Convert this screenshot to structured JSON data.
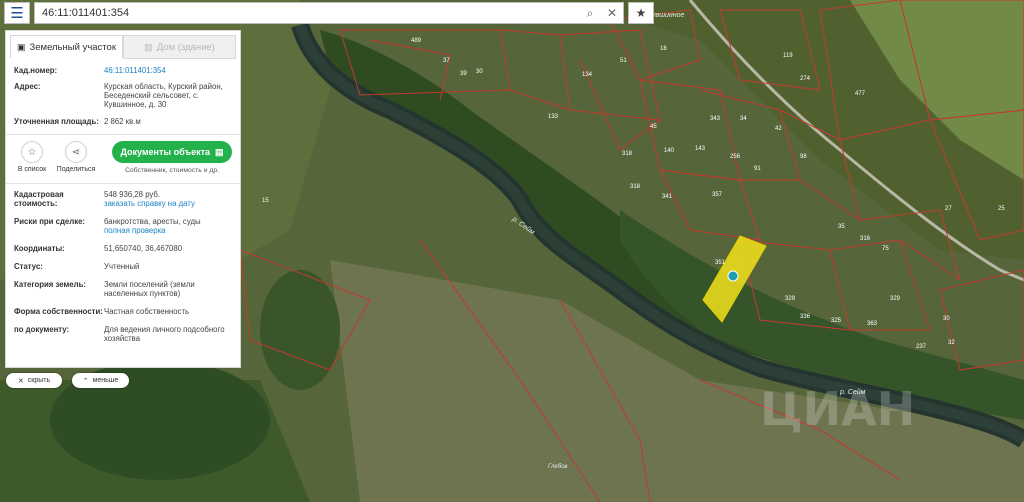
{
  "search": {
    "value": "46:11:011401:354",
    "search_icon": "search-icon",
    "clear_icon": "close-icon"
  },
  "map": {
    "village_label": "Кувшинное",
    "river_label": "р. Сейм",
    "river_label_2": "р. Сейм",
    "watermark": "ЦИАН",
    "selected_plot_color": "#f2e21b",
    "plot_numbers": [
      "489",
      "37",
      "39",
      "30",
      "134",
      "51",
      "18",
      "133",
      "45",
      "140",
      "34",
      "316",
      "318",
      "256",
      "341",
      "42",
      "91",
      "143",
      "343",
      "318",
      "98",
      "357",
      "75",
      "351",
      "329",
      "336",
      "363",
      "325",
      "237",
      "30",
      "32",
      "15",
      "477",
      "274",
      "119",
      "35",
      "27",
      "25",
      "329"
    ],
    "bottom_label": "Глебов"
  },
  "panel": {
    "tabs": [
      {
        "label": "Земельный участок"
      },
      {
        "label": "Дом (здание)"
      }
    ],
    "cad_label": "Кад.номер:",
    "cad_value": "46:11:011401:354",
    "addr_label": "Адрес:",
    "addr_value": "Курская область, Курский район, Беседенский сельсовет, с. Кувшинное, д. 30",
    "area_label": "Уточненная площадь:",
    "area_value": "2 862 кв.м",
    "actions": {
      "list": "В список",
      "share": "Поделиться",
      "docs": "Документы объекта",
      "docs_sub": "Собственник, стоимость и др."
    },
    "cost_label": "Кадастровая стоимость:",
    "cost_value": "548 936,28 руб.",
    "cost_link": "заказать справку на дату",
    "risk_label": "Риски при сделке:",
    "risk_value": "банкротства, аресты, суды",
    "risk_link": "полная проверка",
    "coord_label": "Координаты:",
    "coord_value": "51,650740, 36,467080",
    "status_label": "Статус:",
    "status_value": "Учтенный",
    "cat_label": "Категория земель:",
    "cat_value": "Земли поселений (земли населенных пунктов)",
    "own_label": "Форма собственности:",
    "own_value": "Частная собственность",
    "doc_label": "по документу:",
    "doc_value": "Для ведения личного подсобного хозяйства"
  },
  "buttons": {
    "hide": "скрыть",
    "less": "меньше"
  },
  "colors": {
    "accent_green": "#23b14b",
    "link_blue": "#1b83c5",
    "plot_border": "#d2382f"
  }
}
